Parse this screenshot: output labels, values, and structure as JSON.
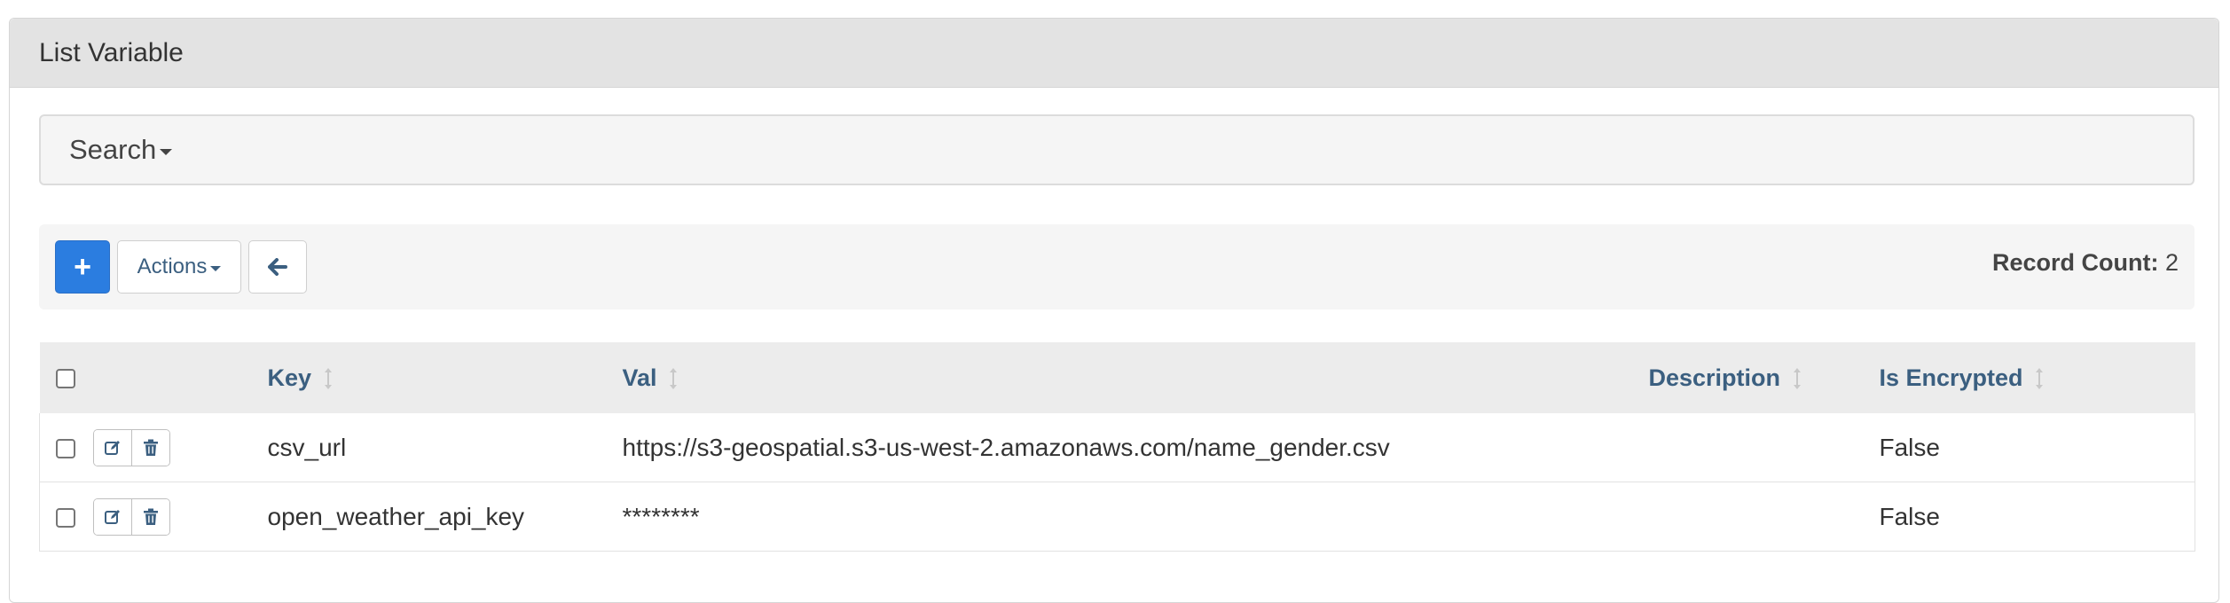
{
  "panel": {
    "title": "List Variable"
  },
  "search": {
    "label": "Search"
  },
  "toolbar": {
    "add_label": "+",
    "actions_label": "Actions",
    "record_count_label": "Record Count:",
    "record_count_value": "2"
  },
  "table": {
    "columns": [
      "Key",
      "Val",
      "Description",
      "Is Encrypted"
    ],
    "rows": [
      {
        "key": "csv_url",
        "val": "https://s3-geospatial.s3-us-west-2.amazonaws.com/name_gender.csv",
        "description": "",
        "is_encrypted": "False"
      },
      {
        "key": "open_weather_api_key",
        "val": "********",
        "description": "",
        "is_encrypted": "False"
      }
    ]
  },
  "colors": {
    "primary": "#2b7de0",
    "link": "#3b5f80",
    "heading_bg": "#e3e3e3"
  },
  "icons": {
    "add": "plus-icon",
    "back": "arrow-left-icon",
    "edit": "edit-icon",
    "delete": "trash-icon",
    "sort": "sort-icon"
  }
}
